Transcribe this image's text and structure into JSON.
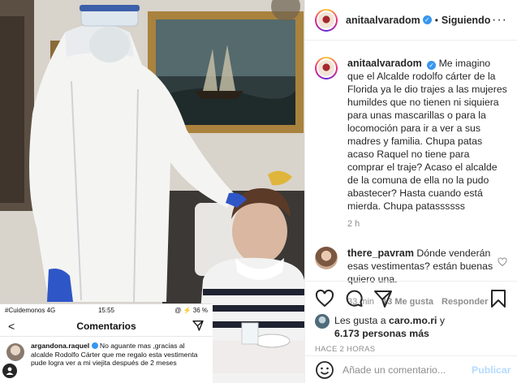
{
  "post": {
    "author": "anitaalvaradom",
    "following_label": "Siguiendo",
    "separator": "•",
    "more_label": "···",
    "caption_author": "anitaalvaradom",
    "caption": "Me imagino que el Alcalde rodolfo cárter de la Florida ya le dio trajes a las mujeres humildes que no tienen ni siquiera para unas mascarillas o para la locomoción para ir a ver a sus madres y familia. Chupa patas acaso Raquel no tiene para comprar el traje? Acaso el alcalde de la comuna de ella no la pudo abastecer? Hasta cuando está mierda. Chupa patassssss",
    "caption_time": "2 h"
  },
  "reply": {
    "author": "there_pavram",
    "text": "Dónde venderán esas vestimentas? están buenas quiero una.",
    "time": "33 min",
    "likes": "13 Me gusta",
    "reply_label": "Responder"
  },
  "likes": {
    "prefix": "Les gusta a",
    "user": "caro.mo.ri",
    "joiner": "y",
    "others": "6.173 personas más"
  },
  "posted_ago": "HACE 2 HORAS",
  "add_comment": {
    "placeholder": "Añade un comentario...",
    "publish_label": "Publicar"
  },
  "embedded_phone": {
    "carrier": "#Cuidemonos 4G",
    "time": "15:55",
    "battery": "@ ⚡ 36 %",
    "title": "Comentarios",
    "back": "<",
    "commenter": "argandona.raquel",
    "comment": "No aguante mas ,gracias al alcalde  Rodolfo Cárter que me regalo esta vestimenta pude logra ver a mi viejita después de 2 meses"
  },
  "icons": {
    "like": "heart-icon",
    "comment": "comment-icon",
    "share": "share-icon",
    "save": "bookmark-icon",
    "emoji": "emoji-icon",
    "verified": "verified-icon"
  },
  "colors": {
    "verified": "#3897f0",
    "publish_disabled": "#b3dbff",
    "meta_gray": "#8e8e8e"
  }
}
